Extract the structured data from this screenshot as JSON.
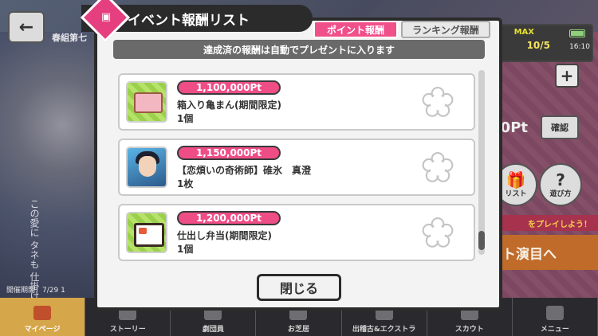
{
  "background": {
    "back_label": "←",
    "side_label": "春組第七",
    "period_label": "開催期間：7/29 1",
    "vertical_text": "この愛に タネも 仕掛けも 無い",
    "max_label": "MAX",
    "stamina": "10/5",
    "time": "16:10",
    "plus_label": "+",
    "points_label": "0Pt",
    "confirm_label": "確認",
    "reward_list_label": "リスト",
    "howto_label": "遊び方",
    "play_banner": "をプレイしよう！",
    "live_label": "ト演目へ"
  },
  "modal": {
    "title": "イベント報酬リスト",
    "tab_point": "ポイント報酬",
    "tab_ranking": "ランキング報酬",
    "info": "達成済の報酬は自動でプレゼントに入ります",
    "close_label": "閉じる",
    "rewards": [
      {
        "points": "1,100,000Pt",
        "name": "箱入り亀まん(期間限定)",
        "qty": "1個"
      },
      {
        "points": "1,150,000Pt",
        "name": "【恋煩いの奇術師】碓氷　真澄",
        "qty": "1枚"
      },
      {
        "points": "1,200,000Pt",
        "name": "仕出し弁当(期間限定)",
        "qty": "1個"
      }
    ]
  },
  "nav": {
    "items": [
      {
        "label": "マイページ"
      },
      {
        "label": "ストーリー"
      },
      {
        "label": "劇団員"
      },
      {
        "label": "お芝居"
      },
      {
        "label": "出稽古&エクストラ"
      },
      {
        "label": "スカウト"
      },
      {
        "label": "メニュー"
      }
    ]
  },
  "colors": {
    "accent": "#ef4d86",
    "dark": "#2b2b2b"
  }
}
